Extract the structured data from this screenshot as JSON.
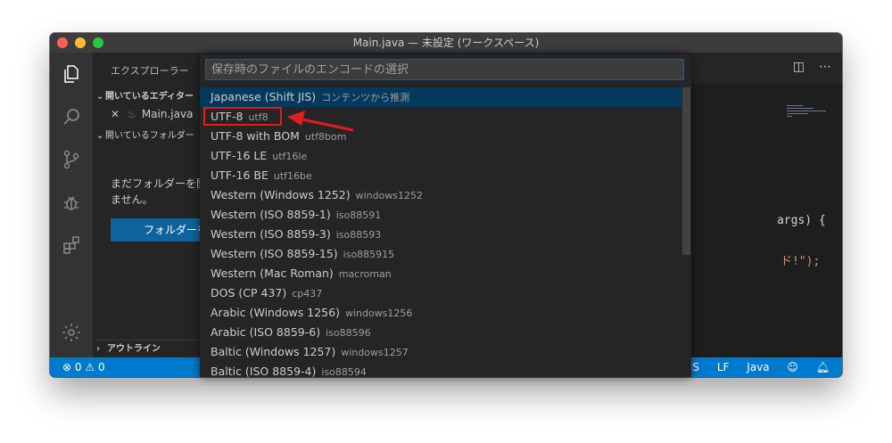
{
  "window": {
    "title": "Main.java — 未設定 (ワークスペース)"
  },
  "sidebar": {
    "title": "エクスプローラー",
    "open_editors": "開いているエディター",
    "open_file": "Main.java",
    "open_folder": "開いているフォルダー",
    "no_folder_msg": "まだフォルダーを開\nません。",
    "open_folder_button": "フォルダーを開く",
    "outline": "アウトライン"
  },
  "editor": {
    "code_fragments": [
      "args) {",
      "ド!\");"
    ]
  },
  "statusbar": {
    "errors": "0",
    "warnings": "0",
    "encoding": "Shift JIS",
    "eol": "LF",
    "language": "Java"
  },
  "quickpick": {
    "placeholder": "保存時のファイルのエンコードの選択",
    "items": [
      {
        "label": "Japanese (Shift JIS)",
        "desc": "コンテンツから推測"
      },
      {
        "label": "UTF-8",
        "desc": "utf8"
      },
      {
        "label": "UTF-8 with BOM",
        "desc": "utf8bom"
      },
      {
        "label": "UTF-16 LE",
        "desc": "utf16le"
      },
      {
        "label": "UTF-16 BE",
        "desc": "utf16be"
      },
      {
        "label": "Western (Windows 1252)",
        "desc": "windows1252"
      },
      {
        "label": "Western (ISO 8859-1)",
        "desc": "iso88591"
      },
      {
        "label": "Western (ISO 8859-3)",
        "desc": "iso88593"
      },
      {
        "label": "Western (ISO 8859-15)",
        "desc": "iso885915"
      },
      {
        "label": "Western (Mac Roman)",
        "desc": "macroman"
      },
      {
        "label": "DOS (CP 437)",
        "desc": "cp437"
      },
      {
        "label": "Arabic (Windows 1256)",
        "desc": "windows1256"
      },
      {
        "label": "Arabic (ISO 8859-6)",
        "desc": "iso88596"
      },
      {
        "label": "Baltic (Windows 1257)",
        "desc": "windows1257"
      },
      {
        "label": "Baltic (ISO 8859-4)",
        "desc": "iso88594"
      }
    ]
  },
  "colors": {
    "accent": "#007acc",
    "highlight": "#e21c1c"
  }
}
